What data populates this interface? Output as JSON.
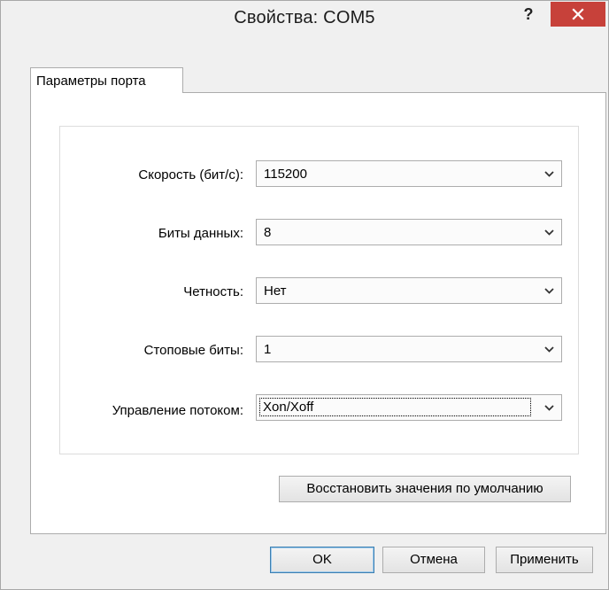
{
  "window": {
    "title": "Свойства: COM5",
    "help_label": "?",
    "close_icon": "close-icon",
    "close_color": "#c7413a"
  },
  "tabs": [
    {
      "label": "Параметры порта",
      "selected": true
    }
  ],
  "settings": {
    "baud": {
      "label": "Скорость (бит/с):",
      "value": "115200"
    },
    "data_bits": {
      "label": "Биты данных:",
      "value": "8"
    },
    "parity": {
      "label": "Четность:",
      "value": "Нет"
    },
    "stop_bits": {
      "label": "Стоповые биты:",
      "value": "1"
    },
    "flow_control": {
      "label": "Управление потоком:",
      "value": "Xon/Xoff"
    }
  },
  "restore_button": "Восстановить значения по умолчанию",
  "buttons": {
    "ok": "OK",
    "cancel": "Отмена",
    "apply": "Применить"
  },
  "accent_color": "#3c7fb1"
}
